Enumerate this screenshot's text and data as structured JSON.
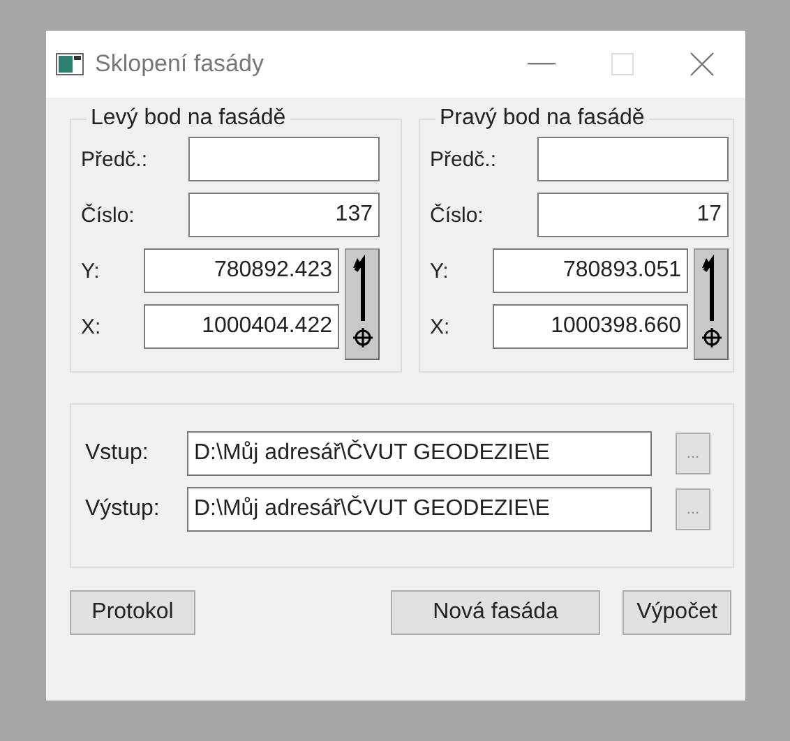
{
  "window": {
    "title": "Sklopení fasády"
  },
  "points": [
    {
      "title": "Levý bod na fasádě",
      "predc": {
        "label": "Předč.:"
      },
      "cislo": {
        "label": "Číslo:",
        "value": "137"
      },
      "y": {
        "label": "Y:",
        "value": "780892.423"
      },
      "x": {
        "label": "X:",
        "value": "1000404.422"
      }
    },
    {
      "title": "Pravý bod na fasádě",
      "predc": {
        "label": "Předč.:"
      },
      "cislo": {
        "label": "Číslo:",
        "value": "17"
      },
      "y": {
        "label": "Y:",
        "value": "780893.051"
      },
      "x": {
        "label": "X:",
        "value": "1000398.660"
      }
    }
  ],
  "files": [
    {
      "label": "Vstup:",
      "value": "D:\\Můj adresář\\ČVUT GEODEZIE\\E",
      "button": "..."
    },
    {
      "label": "Výstup:",
      "value": "D:\\Můj adresář\\ČVUT GEODEZIE\\E",
      "button": "..."
    }
  ],
  "buttons": [
    "Protokol",
    "Nová fasáda",
    "Výpočet"
  ]
}
